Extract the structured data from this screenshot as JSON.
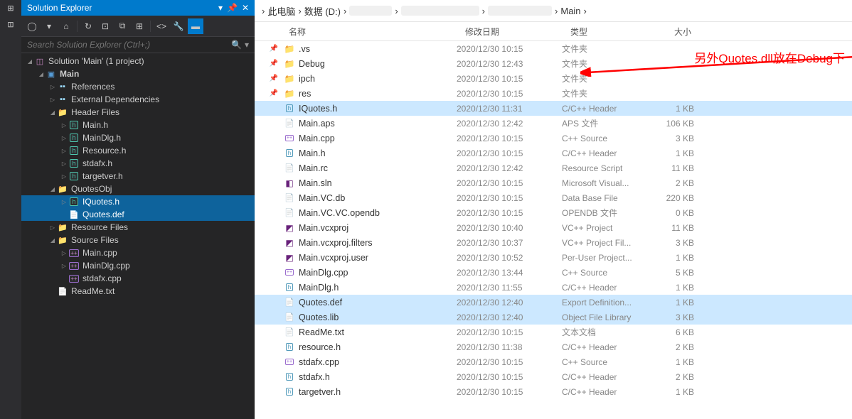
{
  "vs": {
    "title": "Solution Explorer",
    "search_placeholder": "Search Solution Explorer (Ctrl+;)",
    "solution_label": "Solution 'Main' (1 project)",
    "tree": [
      {
        "level": 0,
        "arrow": "expanded",
        "icon": "sln",
        "label": "Solution 'Main' (1 project)",
        "bold": false
      },
      {
        "level": 1,
        "arrow": "expanded",
        "icon": "proj",
        "label": "Main",
        "bold": true
      },
      {
        "level": 2,
        "arrow": "collapsed",
        "icon": "ref",
        "label": "References"
      },
      {
        "level": 2,
        "arrow": "collapsed",
        "icon": "ref",
        "label": "External Dependencies"
      },
      {
        "level": 2,
        "arrow": "expanded",
        "icon": "folder",
        "label": "Header Files"
      },
      {
        "level": 3,
        "arrow": "collapsed",
        "icon": "h",
        "label": "Main.h"
      },
      {
        "level": 3,
        "arrow": "collapsed",
        "icon": "h",
        "label": "MainDlg.h"
      },
      {
        "level": 3,
        "arrow": "collapsed",
        "icon": "h",
        "label": "Resource.h"
      },
      {
        "level": 3,
        "arrow": "collapsed",
        "icon": "h",
        "label": "stdafx.h"
      },
      {
        "level": 3,
        "arrow": "collapsed",
        "icon": "h",
        "label": "targetver.h"
      },
      {
        "level": 2,
        "arrow": "expanded",
        "icon": "folder",
        "label": "QuotesObj"
      },
      {
        "level": 3,
        "arrow": "collapsed",
        "icon": "h",
        "label": "IQuotes.h",
        "selected": true
      },
      {
        "level": 3,
        "arrow": "",
        "icon": "def",
        "label": "Quotes.def",
        "selected": true
      },
      {
        "level": 2,
        "arrow": "collapsed",
        "icon": "folder",
        "label": "Resource Files"
      },
      {
        "level": 2,
        "arrow": "expanded",
        "icon": "folder",
        "label": "Source Files"
      },
      {
        "level": 3,
        "arrow": "collapsed",
        "icon": "cpp",
        "label": "Main.cpp"
      },
      {
        "level": 3,
        "arrow": "collapsed",
        "icon": "cpp",
        "label": "MainDlg.cpp"
      },
      {
        "level": 3,
        "arrow": "",
        "icon": "cpp",
        "label": "stdafx.cpp"
      },
      {
        "level": 2,
        "arrow": "",
        "icon": "txt",
        "label": "ReadMe.txt"
      }
    ]
  },
  "explorer": {
    "breadcrumb": [
      "此电脑",
      "数据 (D:)",
      "",
      "",
      "",
      "Main"
    ],
    "headers": {
      "name": "名称",
      "date": "修改日期",
      "type": "类型",
      "size": "大小"
    },
    "files": [
      {
        "pin": true,
        "icon": "folder",
        "name": ".vs",
        "date": "2020/12/30 10:15",
        "type": "文件夹",
        "size": ""
      },
      {
        "pin": true,
        "icon": "folder",
        "name": "Debug",
        "date": "2020/12/30 12:43",
        "type": "文件夹",
        "size": ""
      },
      {
        "pin": true,
        "icon": "folder",
        "name": "ipch",
        "date": "2020/12/30 10:15",
        "type": "文件夹",
        "size": ""
      },
      {
        "pin": true,
        "icon": "folder",
        "name": "res",
        "date": "2020/12/30 10:15",
        "type": "文件夹",
        "size": ""
      },
      {
        "pin": false,
        "icon": "h",
        "name": "IQuotes.h",
        "date": "2020/12/30 11:31",
        "type": "C/C++ Header",
        "size": "1 KB",
        "hl": true
      },
      {
        "pin": false,
        "icon": "file",
        "name": "Main.aps",
        "date": "2020/12/30 12:42",
        "type": "APS 文件",
        "size": "106 KB"
      },
      {
        "pin": false,
        "icon": "cpp",
        "name": "Main.cpp",
        "date": "2020/12/30 10:15",
        "type": "C++ Source",
        "size": "3 KB"
      },
      {
        "pin": false,
        "icon": "h",
        "name": "Main.h",
        "date": "2020/12/30 10:15",
        "type": "C/C++ Header",
        "size": "1 KB"
      },
      {
        "pin": false,
        "icon": "file",
        "name": "Main.rc",
        "date": "2020/12/30 12:42",
        "type": "Resource Script",
        "size": "11 KB"
      },
      {
        "pin": false,
        "icon": "sln",
        "name": "Main.sln",
        "date": "2020/12/30 10:15",
        "type": "Microsoft Visual...",
        "size": "2 KB"
      },
      {
        "pin": false,
        "icon": "file",
        "name": "Main.VC.db",
        "date": "2020/12/30 10:15",
        "type": "Data Base File",
        "size": "220 KB"
      },
      {
        "pin": false,
        "icon": "file",
        "name": "Main.VC.VC.opendb",
        "date": "2020/12/30 10:15",
        "type": "OPENDB 文件",
        "size": "0 KB"
      },
      {
        "pin": false,
        "icon": "proj",
        "name": "Main.vcxproj",
        "date": "2020/12/30 10:40",
        "type": "VC++ Project",
        "size": "11 KB"
      },
      {
        "pin": false,
        "icon": "proj",
        "name": "Main.vcxproj.filters",
        "date": "2020/12/30 10:37",
        "type": "VC++ Project Fil...",
        "size": "3 KB"
      },
      {
        "pin": false,
        "icon": "proj",
        "name": "Main.vcxproj.user",
        "date": "2020/12/30 10:52",
        "type": "Per-User Project...",
        "size": "1 KB"
      },
      {
        "pin": false,
        "icon": "cpp",
        "name": "MainDlg.cpp",
        "date": "2020/12/30 13:44",
        "type": "C++ Source",
        "size": "5 KB"
      },
      {
        "pin": false,
        "icon": "h",
        "name": "MainDlg.h",
        "date": "2020/12/30 11:55",
        "type": "C/C++ Header",
        "size": "1 KB"
      },
      {
        "pin": false,
        "icon": "file",
        "name": "Quotes.def",
        "date": "2020/12/30 12:40",
        "type": "Export Definition...",
        "size": "1 KB",
        "hl": true
      },
      {
        "pin": false,
        "icon": "file",
        "name": "Quotes.lib",
        "date": "2020/12/30 12:40",
        "type": "Object File Library",
        "size": "3 KB",
        "hl": true
      },
      {
        "pin": false,
        "icon": "file",
        "name": "ReadMe.txt",
        "date": "2020/12/30 10:15",
        "type": "文本文档",
        "size": "6 KB"
      },
      {
        "pin": false,
        "icon": "h",
        "name": "resource.h",
        "date": "2020/12/30 11:38",
        "type": "C/C++ Header",
        "size": "2 KB"
      },
      {
        "pin": false,
        "icon": "cpp",
        "name": "stdafx.cpp",
        "date": "2020/12/30 10:15",
        "type": "C++ Source",
        "size": "1 KB"
      },
      {
        "pin": false,
        "icon": "h",
        "name": "stdafx.h",
        "date": "2020/12/30 10:15",
        "type": "C/C++ Header",
        "size": "2 KB"
      },
      {
        "pin": false,
        "icon": "h",
        "name": "targetver.h",
        "date": "2020/12/30 10:15",
        "type": "C/C++ Header",
        "size": "1 KB"
      }
    ]
  },
  "annotation": "另外Quotes.dll放在Debug下"
}
